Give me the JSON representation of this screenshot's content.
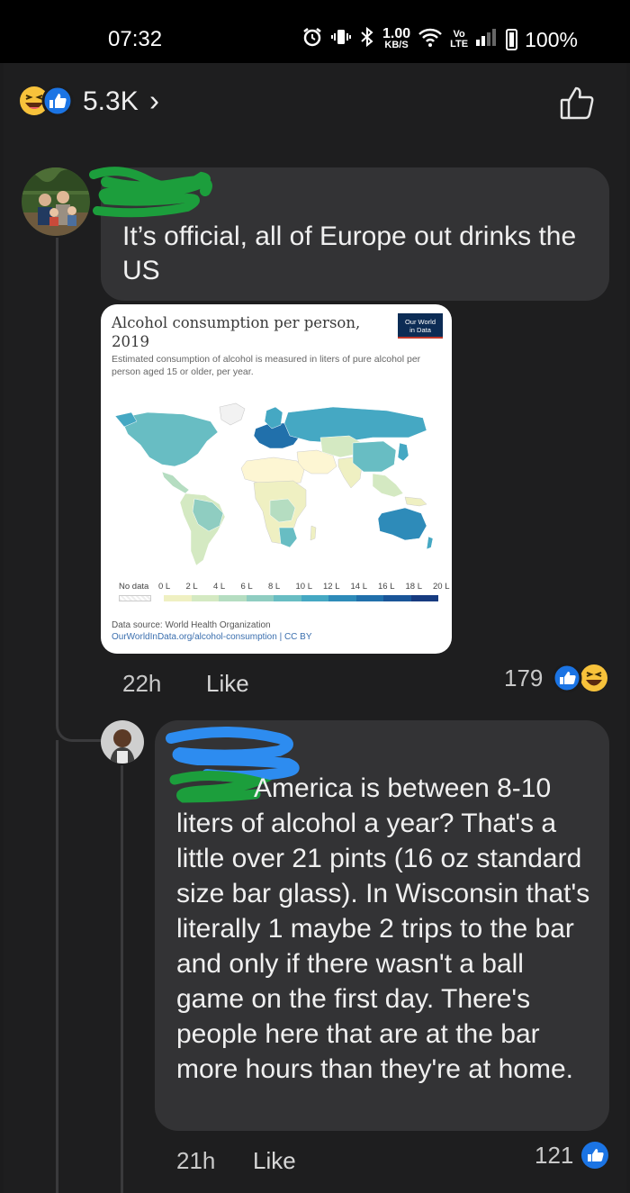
{
  "status_bar": {
    "time": "07:32",
    "net_speed_value": "1.00",
    "net_speed_unit": "KB/S",
    "volte_top": "Vo",
    "volte_bottom": "LTE",
    "battery": "100%",
    "icons": [
      "alarm-icon",
      "vibrate-icon",
      "bluetooth-icon",
      "wifi-icon",
      "signal-icon",
      "battery-icon"
    ]
  },
  "post_reactions": {
    "count": "5.3K",
    "chevron": "›",
    "icons": [
      "haha-reaction-icon",
      "like-reaction-icon"
    ]
  },
  "colors": {
    "background": "#1c1c1d",
    "bubble": "#333335",
    "like_blue": "#1b74e4",
    "haha_yellow": "#f7c23b",
    "redaction_green": "#1c9e3c",
    "redaction_blue": "#2d8cf0"
  },
  "comments": [
    {
      "text": "It’s official, all of Europe out drinks the US",
      "time": "22h",
      "like_label": "Like",
      "reaction_count": "179",
      "attachment": {
        "title": "Alcohol consumption per person, 2019",
        "subtitle": "Estimated consumption of alcohol is measured in liters of pure alcohol per person aged 15 or older, per year.",
        "logo_line1": "Our World",
        "logo_line2": "in Data",
        "legend_no_data": "No data",
        "legend_labels": [
          "0 L",
          "2 L",
          "4 L",
          "6 L",
          "8 L",
          "10 L",
          "12 L",
          "14 L",
          "16 L",
          "18 L",
          "20 L"
        ],
        "legend_colors": [
          "#fdf6d3",
          "#eff0c2",
          "#d4e9c2",
          "#b5ddc1",
          "#8fcdc1",
          "#68bdc3",
          "#45a8c3",
          "#2e8bb9",
          "#2170ab",
          "#1a5598",
          "#173b80"
        ],
        "source_line1": "Data source: World Health Organization",
        "source_line2": "OurWorldInData.org/alcohol-consumption | CC BY"
      }
    },
    {
      "text_first_line": "America is between 8-10",
      "text_rest": "liters of alcohol a year? That's a little over 21 pints (16 oz standard size bar glass). In Wisconsin that's literally 1 maybe 2 trips to the bar and only if there wasn't a ball game on the first day. There's people here that are at the bar more hours than they're at home.",
      "time": "21h",
      "like_label": "Like",
      "reaction_count": "121"
    }
  ]
}
